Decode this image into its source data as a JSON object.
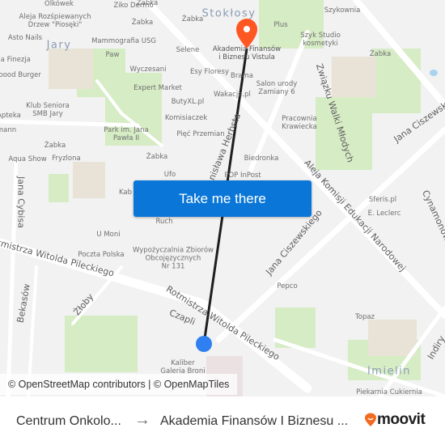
{
  "map": {
    "districts": [
      {
        "name": "Jary"
      },
      {
        "name": "Stokłosy"
      },
      {
        "name": "Imielin"
      }
    ],
    "streets": [
      "Stanisława Herbsta",
      "Aleja Komisji Edukacji Narodowej",
      "Jana Ciszewskiego",
      "Związku Walki Młodych",
      "Rotmistrza Witolda Pileckiego",
      "Rotmistrza Witolda Pileckiego",
      "Jana Cybisa",
      "Bekasów",
      "Żłoby",
      "Czapli",
      "Cynamonowa",
      "Indiry",
      "Jana Ciszewskiego"
    ],
    "pois": [
      "Olkówek",
      "Ziko Dermo",
      "Żabka",
      "Aleja Rozśpiewanych\nDrzew \"Piosęki\"",
      "Asto Nails",
      "Mammografia USG",
      "Paw",
      "Ja Finezja",
      "Soood Burger",
      "Wyczesani",
      "Expert Market",
      "Klub Seniora\nSMB Jary",
      "Apteka",
      "ButyXL.pl",
      "Komisiaczek",
      "Park im. Jana\nPawła II",
      "Żabka",
      "Pięć Przemian",
      "Aqua Show",
      "Fryzlona",
      "Żabka",
      "Ufo",
      "Kab",
      "Żabka",
      "Selene",
      "Esy Floresy",
      "Brama",
      "Wakacje.pl",
      "Plus",
      "Szykownia",
      "Szyk Studio\nkosmetyki",
      "Żabka",
      "Salon urody\nZamiany 6",
      "Pracownia\nKrawiecka",
      "Biedronka",
      "POP InPost",
      "Sferis.pl",
      "E. Leclerc",
      "Ruch",
      "U Moni",
      "Poczta Polska",
      "Wypożyczalnia Zbiorów\nObcojęzycznych\nNr 131",
      "Pepco",
      "Topaz",
      "Kaliber\nGaleria Broni",
      "Piekarnia Cukiernia",
      "Żabka",
      "mann"
    ],
    "destination_label": "Akademia Finansów\ni Biznesu Vistula",
    "take_me_there_label": "Take me there",
    "attribution": "© OpenStreetMap contributors | © OpenMapTiles",
    "colors": {
      "route": "#1e1e1e",
      "origin_dot": "#2f7ff0",
      "destination_pin": "#ff5722",
      "button": "#0a77d8"
    }
  },
  "footer": {
    "from": "Centrum Onkolo...",
    "arrow": "→",
    "to": "Akademia Finansów I Biznesu ...",
    "brand": "moovit"
  }
}
